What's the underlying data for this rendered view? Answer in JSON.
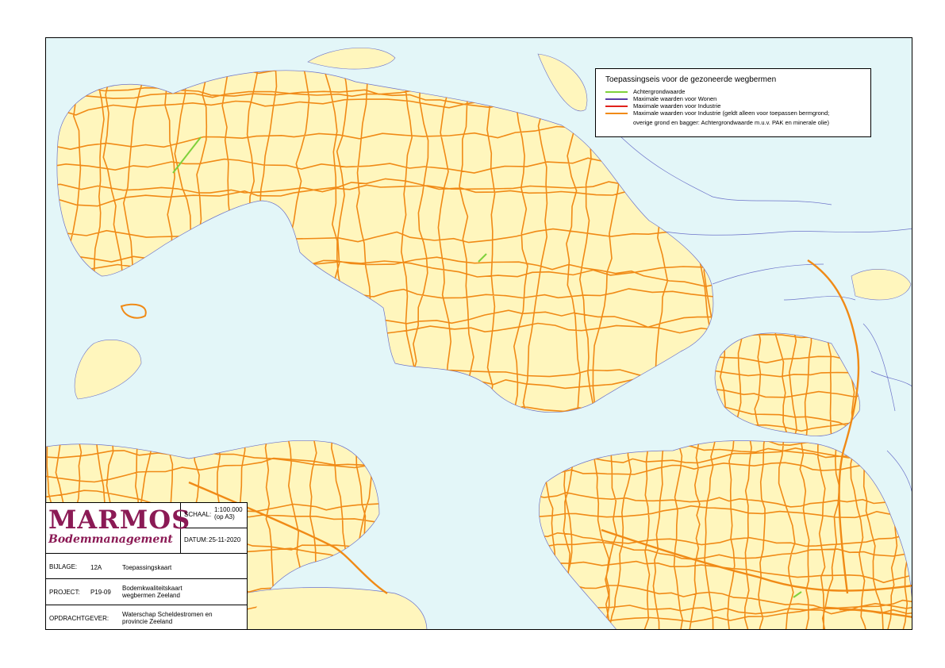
{
  "legend": {
    "title": "Toepassingseis voor de gezoneerde wegbermen",
    "items": [
      {
        "label": "Achtergrondwaarde",
        "color": "#7fd13b"
      },
      {
        "label": "Maximale waarden voor Wonen",
        "color": "#5a3ea8"
      },
      {
        "label": "Maximale waarden voor Industrie",
        "color": "#e0211b"
      },
      {
        "label": "Maximale waarden voor Industrie (geldt alleen voor toepassen bermgrond;",
        "color": "#f08a16"
      }
    ],
    "note": "overige grond en bagger: Achtergrondwaarde m.u.v. PAK en minerale olie)"
  },
  "title_block": {
    "logo_main": "MARMOS",
    "logo_sub": "Bodemmanagement",
    "schaal_label": "SCHAAL:",
    "schaal_value": "1:100.000",
    "schaal_note": "(op A3)",
    "datum_label": "DATUM:",
    "datum_value": "25-11-2020",
    "bijlage_label": "BIJLAGE:",
    "bijlage_number": "12A",
    "bijlage_title": "Toepassingskaart",
    "project_label": "PROJECT:",
    "project_number": "P19-09",
    "project_title_1": "Bodemkwaliteitskaart",
    "project_title_2": "wegbermen Zeeland",
    "opdrachtgever_label": "OPDRACHTGEVER:",
    "opdrachtgever_1": "Waterschap Scheldestromen en",
    "opdrachtgever_2": "provincie Zeeland",
    "logo_color": "#8b1a55"
  },
  "map_colors": {
    "water": "#e3f6f8",
    "land": "#fff6bd",
    "town": "#fdf08c",
    "road": "#f08a16",
    "shoreline": "#6c73c9",
    "background_value_road": "#7fd13b"
  }
}
